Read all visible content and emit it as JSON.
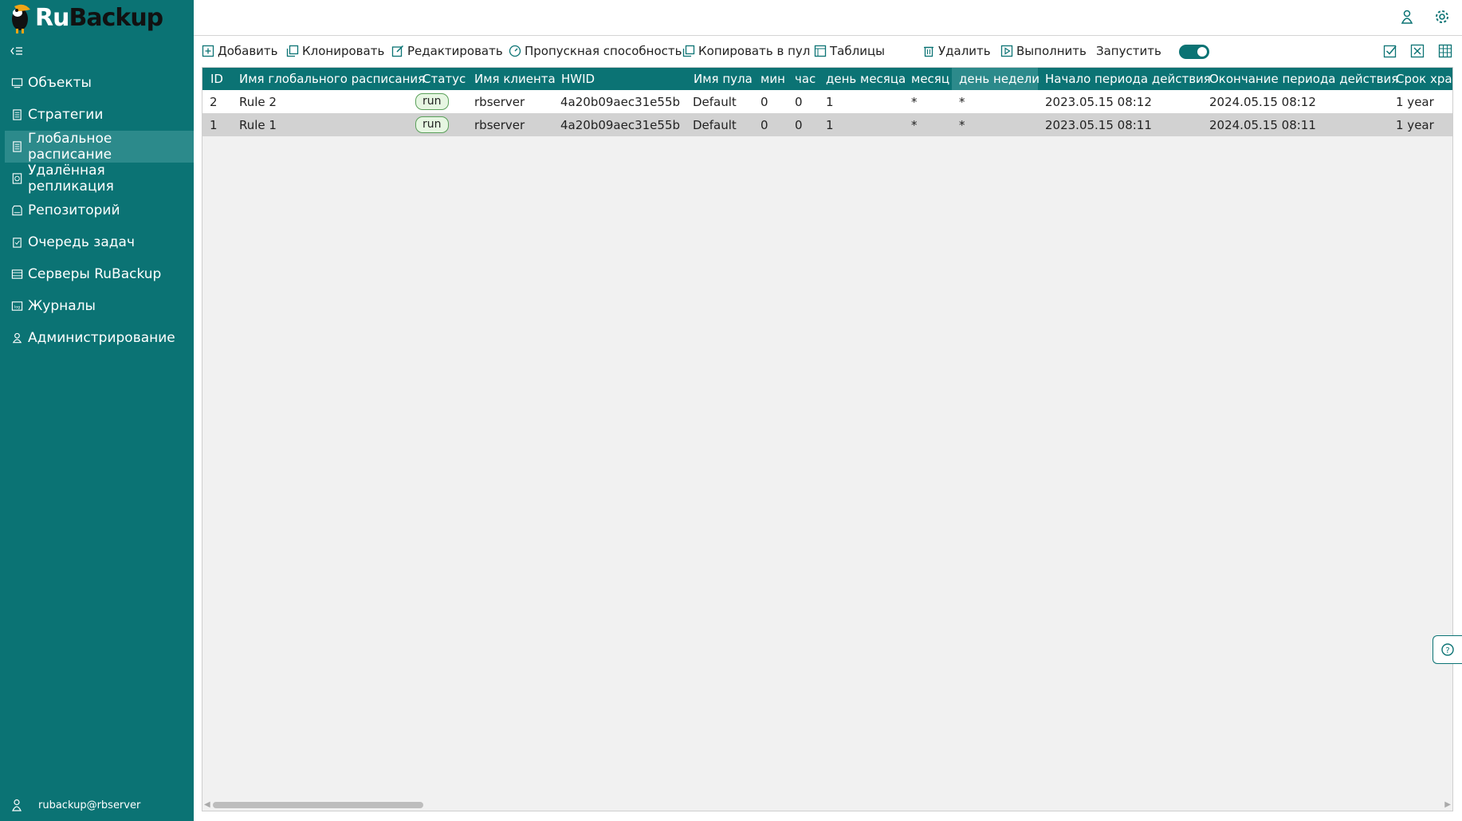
{
  "app": {
    "logo_ru": "Ru",
    "logo_backup": "Backup"
  },
  "colors": {
    "accent": "#0b7374",
    "accent_active": "#2c8a8b",
    "row_selected": "#d2d2d2",
    "badge_green": "#e6f6e2"
  },
  "sidebar": {
    "collapse_icon": "collapse-menu-icon",
    "items": [
      {
        "label": "Объекты",
        "icon": "monitor-icon"
      },
      {
        "label": "Стратегии",
        "icon": "document-icon"
      },
      {
        "label": "Глобальное расписание",
        "icon": "document-icon",
        "active": true
      },
      {
        "label": "Удалённая репликация",
        "icon": "replication-icon"
      },
      {
        "label": "Репозиторий",
        "icon": "storage-icon"
      },
      {
        "label": "Очередь задач",
        "icon": "clipboard-icon"
      },
      {
        "label": "Серверы RuBackup",
        "icon": "server-icon"
      },
      {
        "label": "Журналы",
        "icon": "log-icon"
      },
      {
        "label": "Администрирование",
        "icon": "admin-icon"
      }
    ],
    "user": "rubackup@rbserver"
  },
  "toolbar": {
    "add": "Добавить",
    "clone": "Клонировать",
    "edit": "Редактировать",
    "bandwidth": "Пропускная способность",
    "copy_to_pool": "Копировать в пул",
    "tables": "Таблицы",
    "delete": "Удалить",
    "execute": "Выполнить",
    "run": "Запустить",
    "run_toggle_on": true
  },
  "table": {
    "columns": [
      "ID",
      "Имя глобального расписания",
      "Статус",
      "Имя клиента",
      "HWID",
      "Имя пула",
      "мин",
      "час",
      "день месяца",
      "месяц",
      "день недели",
      "Начало периода действия",
      "Окончание периода действия",
      "Срок хран"
    ],
    "selected_column": "день недели",
    "rows": [
      [
        "2",
        "Rule 2",
        "run",
        "rbserver",
        "4a20b09aec31e55b",
        "Default",
        "0",
        "0",
        "1",
        "*",
        "*",
        "2023.05.15 08:12",
        "2024.05.15 08:12",
        "1 year"
      ],
      [
        "1",
        "Rule 1",
        "run",
        "rbserver",
        "4a20b09aec31e55b",
        "Default",
        "0",
        "0",
        "1",
        "*",
        "*",
        "2023.05.15 08:11",
        "2024.05.15 08:11",
        "1 year"
      ]
    ],
    "selected_row": 1
  }
}
